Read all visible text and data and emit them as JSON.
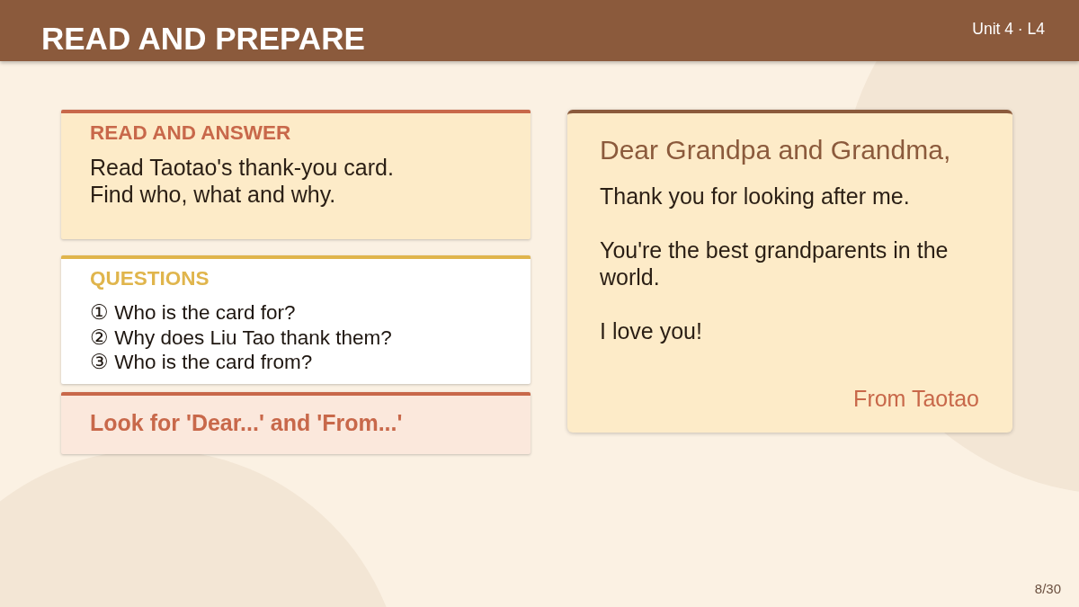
{
  "header": {
    "title": "READ AND PREPARE",
    "unit": "Unit 4 · L4"
  },
  "panels": [
    {
      "kind": "instruction",
      "title": "READ AND ANSWER",
      "lines": [
        "Read Taotao's thank-you card.",
        "Find who, what and why."
      ]
    },
    {
      "kind": "questions",
      "title": "QUESTIONS",
      "items": [
        "① Who is the card for?",
        "② Why does Liu Tao thank them?",
        "③ Who is the card from?"
      ]
    },
    {
      "kind": "tip",
      "text": "Look for 'Dear...' and 'From...'"
    }
  ],
  "card": {
    "greeting": "Dear Grandpa and Grandma,",
    "paragraphs": [
      "Thank you for looking after me.",
      "You're the best grandparents in the world.",
      "I love you!"
    ],
    "signature": "From Taotao"
  },
  "page_number": "8/30"
}
